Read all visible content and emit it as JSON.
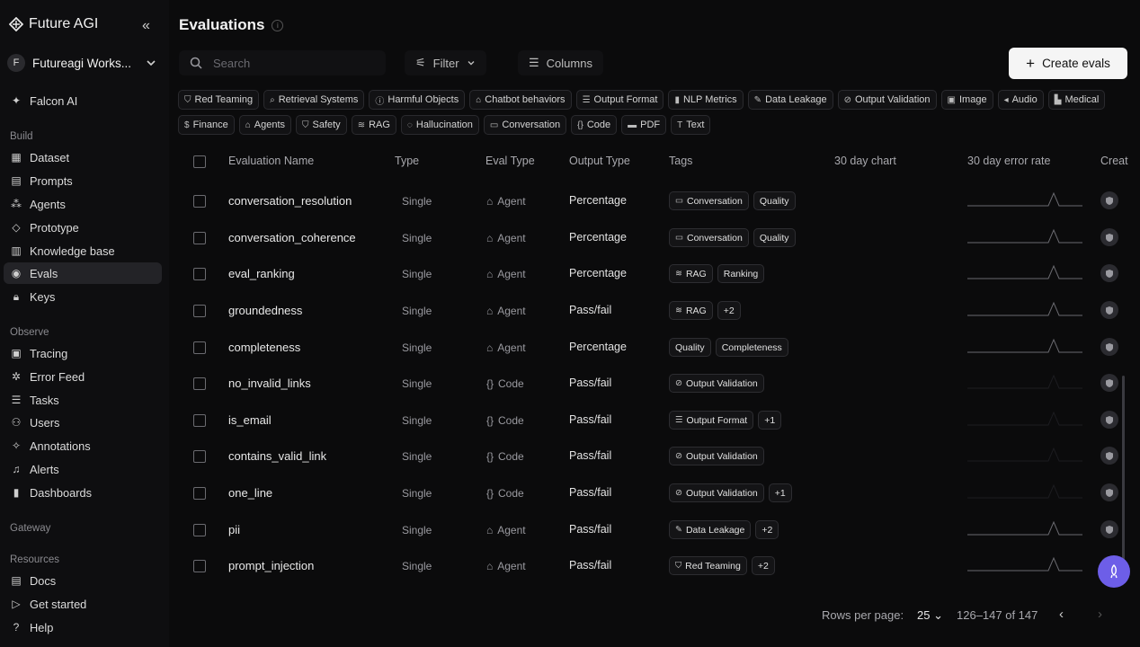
{
  "app": {
    "brand": "Future AGI",
    "workspace_initial": "F",
    "workspace_name": "Futureagi Works..."
  },
  "sidebar": {
    "top_item": "Falcon AI",
    "sections": {
      "build": "Build",
      "observe": "Observe",
      "gateway": "Gateway",
      "resources": "Resources"
    },
    "build_items": [
      "Dataset",
      "Prompts",
      "Agents",
      "Prototype",
      "Knowledge base",
      "Evals",
      "Keys"
    ],
    "observe_items": [
      "Tracing",
      "Error Feed",
      "Tasks",
      "Users",
      "Annotations",
      "Alerts",
      "Dashboards"
    ],
    "resource_items": [
      "Docs",
      "Get started",
      "Help"
    ]
  },
  "header": {
    "title": "Evaluations",
    "info": "i"
  },
  "toolbar": {
    "search_placeholder": "Search",
    "filter_label": "Filter",
    "columns_label": "Columns",
    "create_label": "Create evals"
  },
  "filters": {
    "row1": [
      "Red Teaming",
      "Retrieval Systems",
      "Harmful Objects",
      "Chatbot behaviors",
      "Output Format",
      "NLP Metrics",
      "Data Leakage",
      "Output Validation",
      "Image",
      "Audio",
      "Medical"
    ],
    "row2": [
      "Finance",
      "Agents",
      "Safety",
      "RAG",
      "Hallucination",
      "Conversation",
      "Code",
      "PDF",
      "Text"
    ]
  },
  "table": {
    "columns": [
      "Evaluation Name",
      "Type",
      "Eval Type",
      "Output Type",
      "Tags",
      "30 day chart",
      "30 day error rate",
      "Creat"
    ],
    "rows": [
      {
        "name": "conversation_resolution",
        "type": "Single",
        "eval_type": "Agent",
        "output_type": "Percentage",
        "tags": [
          "Conversation",
          "Quality"
        ],
        "tag_icons": [
          "chat-icon",
          ""
        ]
      },
      {
        "name": "conversation_coherence",
        "type": "Single",
        "eval_type": "Agent",
        "output_type": "Percentage",
        "tags": [
          "Conversation",
          "Quality"
        ],
        "tag_icons": [
          "chat-icon",
          ""
        ]
      },
      {
        "name": "eval_ranking",
        "type": "Single",
        "eval_type": "Agent",
        "output_type": "Percentage",
        "tags": [
          "RAG",
          "Ranking"
        ],
        "tag_icons": [
          "rag-icon",
          ""
        ]
      },
      {
        "name": "groundedness",
        "type": "Single",
        "eval_type": "Agent",
        "output_type": "Pass/fail",
        "tags": [
          "RAG",
          "+2"
        ],
        "tag_icons": [
          "rag-icon",
          ""
        ]
      },
      {
        "name": "completeness",
        "type": "Single",
        "eval_type": "Agent",
        "output_type": "Percentage",
        "tags": [
          "Quality",
          "Completeness"
        ],
        "tag_icons": [
          "",
          ""
        ]
      },
      {
        "name": "no_invalid_links",
        "type": "Single",
        "eval_type": "Code",
        "output_type": "Pass/fail",
        "tags": [
          "Output Validation"
        ],
        "tag_icons": [
          "check-circle-icon"
        ]
      },
      {
        "name": "is_email",
        "type": "Single",
        "eval_type": "Code",
        "output_type": "Pass/fail",
        "tags": [
          "Output Format",
          "+1"
        ],
        "tag_icons": [
          "list-icon",
          ""
        ]
      },
      {
        "name": "contains_valid_link",
        "type": "Single",
        "eval_type": "Code",
        "output_type": "Pass/fail",
        "tags": [
          "Output Validation"
        ],
        "tag_icons": [
          "check-circle-icon"
        ]
      },
      {
        "name": "one_line",
        "type": "Single",
        "eval_type": "Code",
        "output_type": "Pass/fail",
        "tags": [
          "Output Validation",
          "+1"
        ],
        "tag_icons": [
          "check-circle-icon",
          ""
        ]
      },
      {
        "name": "pii",
        "type": "Single",
        "eval_type": "Agent",
        "output_type": "Pass/fail",
        "tags": [
          "Data Leakage",
          "+2"
        ],
        "tag_icons": [
          "leak-icon",
          ""
        ]
      },
      {
        "name": "prompt_injection",
        "type": "Single",
        "eval_type": "Agent",
        "output_type": "Pass/fail",
        "tags": [
          "Red Teaming",
          "+2"
        ],
        "tag_icons": [
          "shield-icon",
          ""
        ]
      }
    ]
  },
  "pagination": {
    "rows_label": "Rows per page:",
    "rows_value": "25",
    "range": "126–147 of 147"
  },
  "colors": {
    "accent": "#6d5ee8",
    "background": "#0b0b0c",
    "sidebar": "#0e0e10"
  }
}
